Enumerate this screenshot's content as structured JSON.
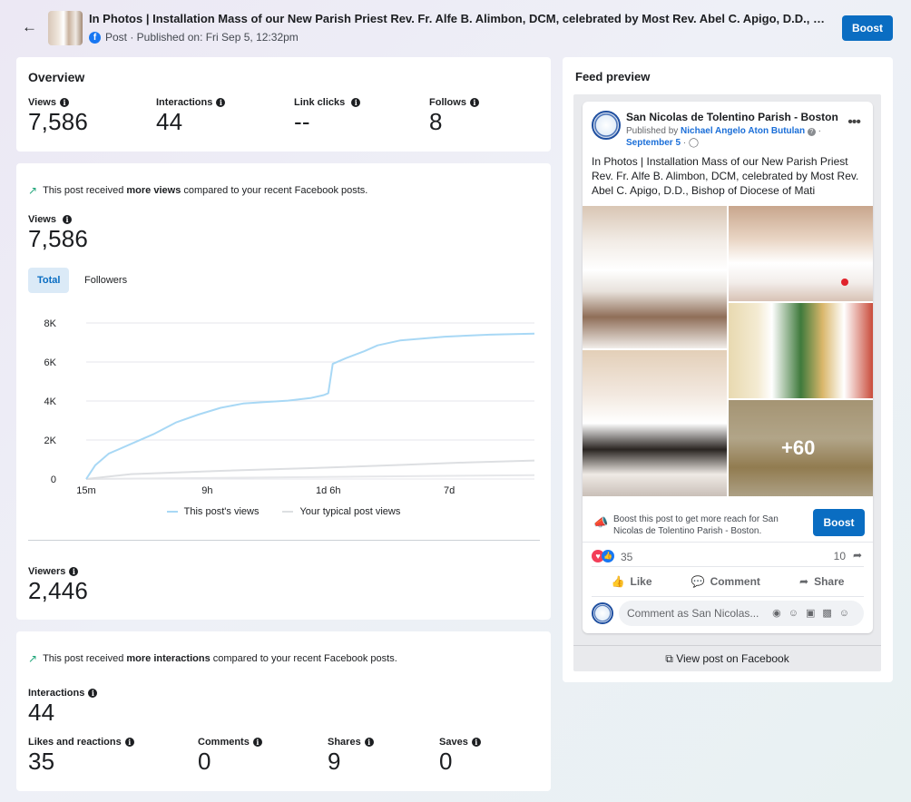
{
  "header": {
    "title": "In Photos | Installation Mass of our New Parish Priest Rev. Fr. Alfe B. Alimbon, DCM, celebrated by Most Rev. Abel C. Apigo, D.D., Bishop ...",
    "subtitle": "Post · Published on: Fri Sep 5, 12:32pm",
    "boost_label": "Boost"
  },
  "overview": {
    "title": "Overview",
    "metrics": [
      {
        "label": "Views",
        "value": "7,586"
      },
      {
        "label": "Interactions",
        "value": "44"
      },
      {
        "label": "Link clicks",
        "value": "--"
      },
      {
        "label": "Follows",
        "value": "8"
      }
    ]
  },
  "views_card": {
    "note_prefix": "This post received ",
    "note_bold": "more views",
    "note_suffix": " compared to your recent Facebook posts.",
    "views_label": "Views",
    "views_value": "7,586",
    "tabs": [
      "Total",
      "Followers"
    ],
    "legend": [
      "This post's views",
      "Your typical post views"
    ],
    "viewers_label": "Viewers",
    "viewers_value": "2,446"
  },
  "chart_data": {
    "type": "line",
    "x_ticks": [
      "15m",
      "9h",
      "1d 6h",
      "7d"
    ],
    "y_ticks": [
      "0",
      "2K",
      "4K",
      "6K",
      "8K"
    ],
    "ylim": [
      0,
      8000
    ],
    "legend": "bottom",
    "grid": true,
    "series": [
      {
        "name": "This post's views",
        "color": "#a8d8f5",
        "x": [
          0,
          0.02,
          0.05,
          0.1,
          0.15,
          0.2,
          0.25,
          0.3,
          0.35,
          0.4,
          0.45,
          0.5,
          0.53,
          0.54,
          0.55,
          0.58,
          0.62,
          0.65,
          0.7,
          0.8,
          0.9,
          1.0
        ],
        "y": [
          0,
          700,
          1300,
          1800,
          2300,
          2900,
          3300,
          3650,
          3870,
          3950,
          4020,
          4150,
          4300,
          4400,
          5900,
          6200,
          6550,
          6850,
          7100,
          7300,
          7400,
          7450
        ]
      },
      {
        "name": "Your typical post views",
        "color": "#dddfe2",
        "x": [
          0,
          0.1,
          0.3,
          0.5,
          0.7,
          0.85,
          1.0
        ],
        "y": [
          0,
          250,
          420,
          560,
          720,
          850,
          950
        ]
      },
      {
        "name": "",
        "color": "#e6e7ea",
        "x": [
          0,
          0.3,
          0.6,
          1.0
        ],
        "y": [
          0,
          60,
          120,
          200
        ]
      }
    ]
  },
  "interactions_card": {
    "note_prefix": "This post received ",
    "note_bold": "more interactions",
    "note_suffix": " compared to your recent Facebook posts.",
    "label": "Interactions",
    "value": "44",
    "metrics": [
      {
        "label": "Likes and reactions",
        "value": "35"
      },
      {
        "label": "Comments",
        "value": "0"
      },
      {
        "label": "Shares",
        "value": "9"
      },
      {
        "label": "Saves",
        "value": "0"
      }
    ]
  },
  "feed_preview": {
    "title": "Feed preview",
    "page_name": "San Nicolas de Tolentino Parish - Boston",
    "published_by_prefix": "Published by ",
    "publisher": "Nichael Angelo Aton Butulan",
    "date": "September 5",
    "caption": "In Photos | Installation Mass of our New Parish Priest Rev. Fr. Alfe B. Alimbon, DCM, celebrated by Most Rev. Abel C. Apigo, D.D., Bishop of Diocese of Mati",
    "more_photos": "+60",
    "boost_text": "Boost this post to get more reach for San Nicolas de Tolentino Parish - Boston.",
    "boost_label": "Boost",
    "reaction_count": "35",
    "share_count": "10",
    "actions": [
      "Like",
      "Comment",
      "Share"
    ],
    "comment_placeholder": "Comment as San Nicolas...",
    "view_post": "View post on Facebook"
  }
}
